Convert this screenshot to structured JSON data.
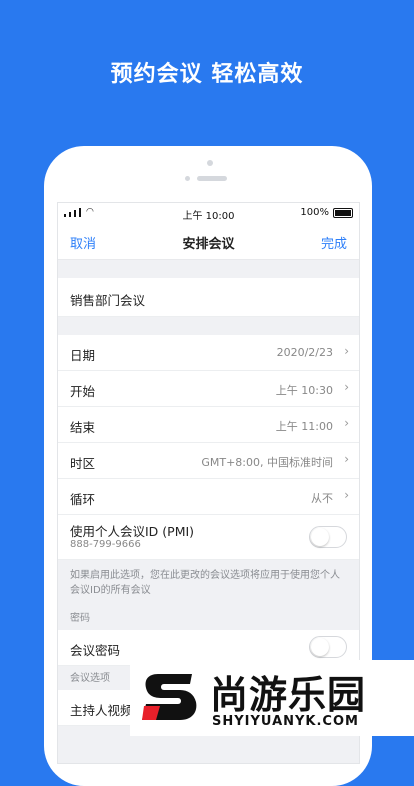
{
  "headline": "预约会议 轻松高效",
  "status_bar": {
    "time": "上午 10:00",
    "battery": "100%"
  },
  "nav": {
    "left": "取消",
    "title": "安排会议",
    "right": "完成"
  },
  "meeting_title": "销售部门会议",
  "rows": [
    {
      "label": "日期",
      "value": "2020/2/23"
    },
    {
      "label": "开始",
      "value": "上午 10:30"
    },
    {
      "label": "结束",
      "value": "上午 11:00"
    },
    {
      "label": "时区",
      "value": "GMT+8:00, 中国标准时间"
    },
    {
      "label": "循环",
      "value": "从不"
    }
  ],
  "pmi": {
    "label": "使用个人会议ID (PMI)",
    "number": "888-799-9666",
    "enabled": false
  },
  "pmi_note": "如果启用此选项，您在此更改的会议选项将应用于使用您个人会议ID的所有会议",
  "password_section": {
    "header": "密码",
    "label": "会议密码",
    "enabled": false
  },
  "options_section": {
    "header": "会议选项",
    "host_video_label": "主持人视频"
  },
  "watermark": {
    "name": "尚游乐园",
    "domain": "SHYIYUANYK.COM"
  },
  "colors": {
    "background": "#2979ef",
    "accent": "#2d7ff9",
    "watermark_red": "#e8202a"
  }
}
